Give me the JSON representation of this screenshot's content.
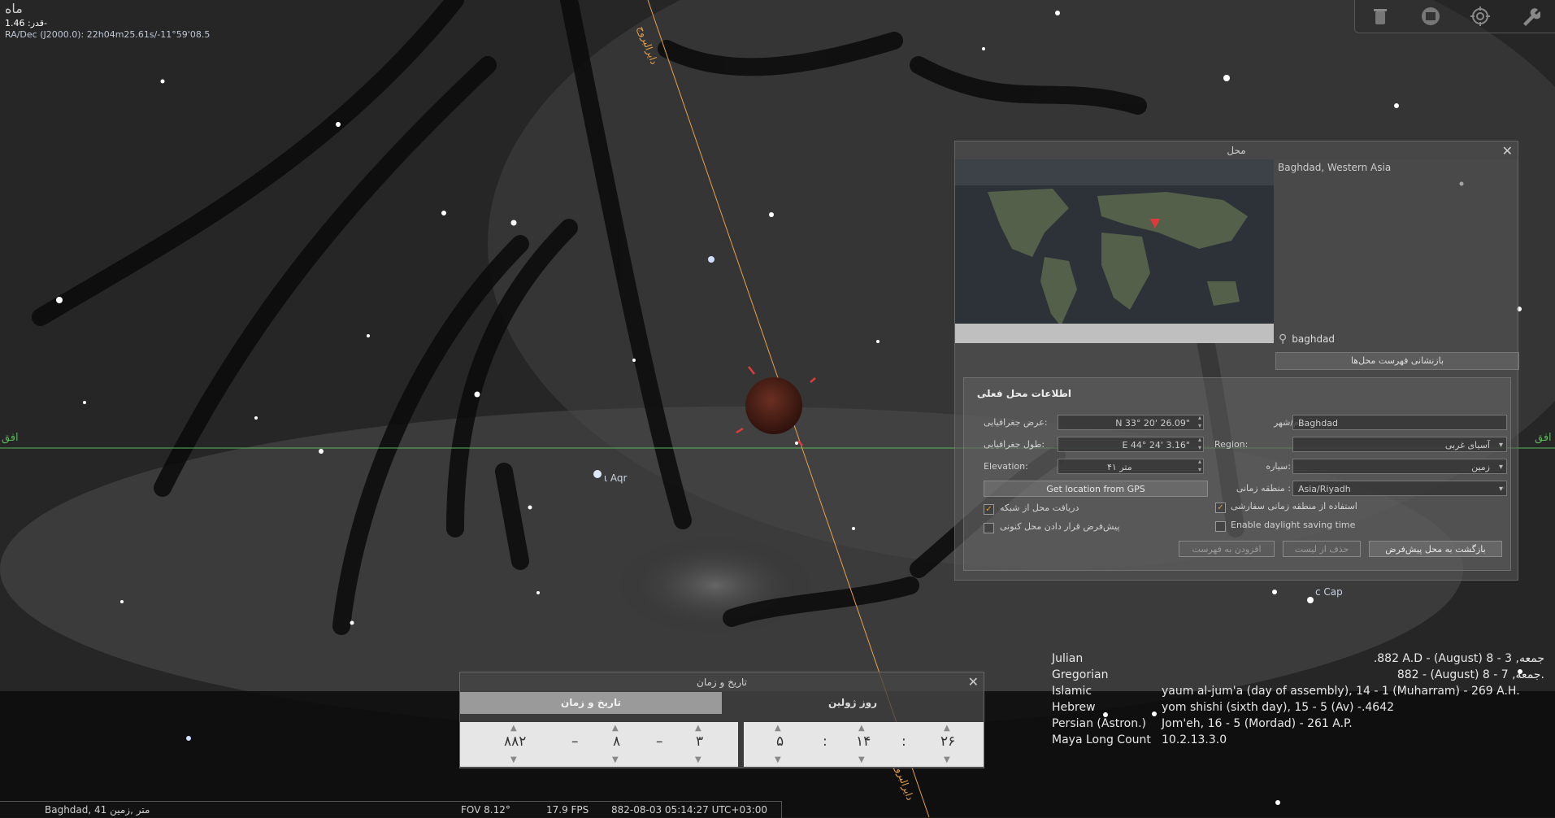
{
  "object_info": {
    "name": "ماه",
    "magnitude": "قدر: 1.46-",
    "radec": "RA/Dec (J2000.0): 22h04m25.61s/-11°59'08.5"
  },
  "toolbar": {
    "icons": [
      "trash-icon",
      "stop-icon",
      "target-icon",
      "wrench-icon"
    ]
  },
  "sky_labels": {
    "horizon_left": "افق",
    "horizon_right": "افق",
    "ecliptic_top": "دایرالبروج",
    "ecliptic_bottom": "دایرالبروج",
    "star_iota_aqr": "ι Aqr",
    "star_c_cap": "c Cap"
  },
  "location_dialog": {
    "title": "محل",
    "city_list_item": "Baghdad, Western Asia",
    "search_value": "baghdad",
    "reset_list_button": "بازنشانی فهرست محل‌ها",
    "current_location_header": "اطلاعات محل فعلی",
    "latitude_label": "عرض جغرافیایی:",
    "latitude_value": "N 33° 20' 26.09\"",
    "longitude_label": "طول جغرافیایی:",
    "longitude_value": "E 44° 24' 3.16\"",
    "elevation_label": "Elevation:",
    "elevation_value": "۴۱ متر",
    "gps_button": "Get location from GPS",
    "name_label": "نام/شهر:",
    "name_value": "Baghdad",
    "region_label": "Region:",
    "region_value": "آسیای غربی",
    "planet_label": "سیاره:",
    "planet_value": "زمین",
    "timezone_label": "منطقه زمانی :",
    "timezone_value": "Asia/Riyadh",
    "chk_network_location": "دریافت محل از شبکه",
    "chk_default_location": "پیش‌فرض قرار دادن محل کنونی",
    "chk_custom_timezone": "استفاده از منطقه زمانی سفارشی",
    "chk_dst": "Enable daylight saving time",
    "add_to_list_button": "افزودن به فهرست",
    "delete_from_list_button": "حذف از لیست",
    "return_default_button": "بازگشت به محل پیش‌فرض"
  },
  "calendars": [
    {
      "name": "Julian",
      "value": ".882 A.D - (August) 8 - 3 ,جمعه",
      "align": "right"
    },
    {
      "name": "Gregorian",
      "value": "882 - (August) 8 - 7 ,جمعه.",
      "align": "right"
    },
    {
      "name": "Islamic",
      "value": "yaum al-jum'a (day of assembly), 14 - 1 (Muharram) - 269 A.H.",
      "align": "left"
    },
    {
      "name": "Hebrew",
      "value": "yom shishi (sixth day), 15 - 5 (Av) -.4642",
      "align": "left"
    },
    {
      "name": "Persian (Astron.)",
      "value": "Jom'eh, 16 - 5 (Mordad) - 261 A.P.",
      "align": "left"
    },
    {
      "name": "Maya Long Count",
      "value": "10.2.13.3.0",
      "align": "left"
    }
  ],
  "datetime_dialog": {
    "title": "تاریخ و زمان",
    "tab_datetime": "تاریخ و زمان",
    "tab_julian": "روز ژولین",
    "year": "۸۸۲",
    "month": "۸",
    "day": "۳",
    "hour": "۵",
    "minute": "۱۴",
    "second": "۲۶",
    "date_sep": "–",
    "time_sep": ":"
  },
  "statusbar": {
    "location": "Baghdad, 41 متر ,زمین",
    "fov": "FOV 8.12°",
    "fps": "17.9 FPS",
    "datetime": "882-08-03 05:14:27 UTC+03:00"
  }
}
